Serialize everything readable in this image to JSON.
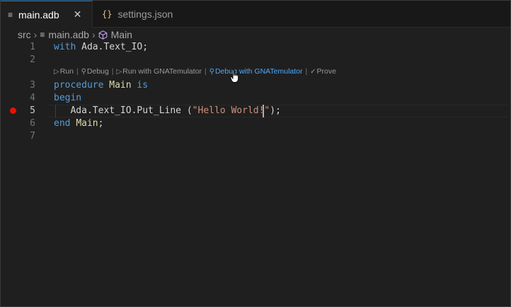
{
  "tabs": [
    {
      "label": "main.adb",
      "icon": "text-lines-icon",
      "active": true,
      "close": "✕"
    },
    {
      "label": "settings.json",
      "icon": "json-braces-icon",
      "icon_glyph": "{}",
      "active": false
    }
  ],
  "breadcrumb": {
    "folder": "src",
    "file": "main.adb",
    "symbol": "Main",
    "separator": "›"
  },
  "codelens": {
    "items": [
      {
        "glyph": "▷",
        "label": "Run"
      },
      {
        "glyph": "⚲",
        "label": "Debug"
      },
      {
        "glyph": "▷",
        "label": "Run with GNATemulator"
      },
      {
        "glyph": "⚲",
        "label": "Debug with GNATemulator"
      },
      {
        "glyph": "✓",
        "label": "Prove"
      }
    ],
    "separator": "|"
  },
  "editor": {
    "line_numbers": [
      "1",
      "2",
      "3",
      "4",
      "5",
      "6",
      "7"
    ],
    "active_line": "5",
    "breakpoint_line": "5",
    "lines": [
      [
        {
          "t": "with",
          "c": "kw"
        },
        {
          "t": " ",
          "c": "pl"
        },
        {
          "t": "Ada.Text_IO",
          "c": "pl"
        },
        {
          "t": ";",
          "c": "pl"
        }
      ],
      [],
      [
        {
          "t": "procedure",
          "c": "kw"
        },
        {
          "t": " ",
          "c": "pl"
        },
        {
          "t": "Main",
          "c": "fn"
        },
        {
          "t": " ",
          "c": "pl"
        },
        {
          "t": "is",
          "c": "kw"
        }
      ],
      [
        {
          "t": "begin",
          "c": "kw"
        }
      ],
      [
        {
          "t": "   Ada.Text_IO.Put_Line (",
          "c": "pl"
        },
        {
          "t": "\"Hello World!\"",
          "c": "str"
        },
        {
          "t": ");",
          "c": "pl"
        }
      ],
      [
        {
          "t": "end",
          "c": "kw"
        },
        {
          "t": " ",
          "c": "pl"
        },
        {
          "t": "Main",
          "c": "fn"
        },
        {
          "t": ";",
          "c": "pl"
        }
      ],
      []
    ]
  },
  "colors": {
    "background": "#1f1f1f",
    "keyword": "#569cd6",
    "string": "#ce9178",
    "function": "#dcdcaa",
    "breakpoint": "#e51400",
    "link_hover": "#4daafc"
  }
}
